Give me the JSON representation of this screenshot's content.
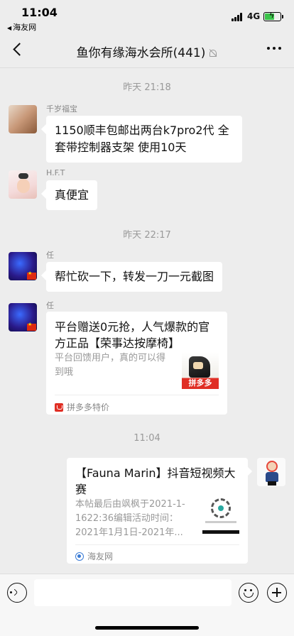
{
  "status_bar": {
    "time": "11:04",
    "back_app": "海友网",
    "network": "4G"
  },
  "nav": {
    "title": "鱼你有缘海水会所(441)"
  },
  "messages": {
    "ts1": "昨天 21:18",
    "m1_sender": "千岁福宝",
    "m1_text": "1150顺丰包邮出两台k7pro2代 全套带控制器支架 使用10天",
    "m2_sender": "H.F.T",
    "m2_text": "真便宜",
    "ts2": "昨天 22:17",
    "m3_sender": "任",
    "m3_text": "帮忙砍一下，转发一刀一元截图",
    "m4_sender": "任",
    "card1": {
      "title": "平台赠送0元抢，人气爆款的官方正品【荣事达按摩椅】",
      "desc": "平台回馈用户，真的可以得到哦",
      "thumb_label": "拼多多",
      "source": "拼多多特价"
    },
    "ts3": "11:04",
    "card2": {
      "title": "【Fauna Marin】抖音短视频大赛",
      "desc": "本帖最后由飒枫于2021-1-1622:36编辑活动时间：2021年1月1日-2021年...",
      "source": "海友网"
    }
  },
  "input": {
    "value": ""
  },
  "icons": {
    "voice": "voice-icon",
    "emoji": "emoji-icon",
    "plus": "plus-icon",
    "mute": "mute-icon",
    "more": "more-icon",
    "back": "back-icon"
  },
  "colors": {
    "background": "#ededed",
    "bubble": "#ffffff",
    "timestamp": "#999999",
    "pdd_red": "#e02e24",
    "battery_green": "#3bc44a"
  }
}
